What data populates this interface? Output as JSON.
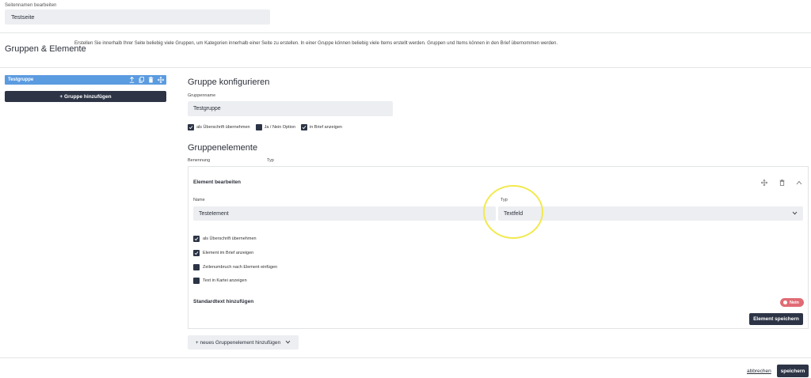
{
  "page_name": {
    "label": "Seitennamen bearbeiten",
    "value": "Testseite"
  },
  "groups_section": {
    "title": "Gruppen & Elemente",
    "description": "Erstellen Sie innerhalb Ihrer Seite beliebig viele Gruppen, um Kategorien innerhalb einer Seite zu erstellen. In einer Gruppe können beliebig viele Items erstellt werden. Gruppen und Items können in den Brief übernommen werden."
  },
  "sidebar": {
    "group_name": "Testgruppe",
    "group_icons": [
      "upload-icon",
      "copy-icon",
      "trash-icon",
      "move-icon"
    ],
    "add_group_label": "+ Gruppe hinzufügen"
  },
  "configure": {
    "title": "Gruppe konfigurieren",
    "groupname_label": "Gruppenname",
    "groupname_value": "Testgruppe",
    "options": [
      {
        "label": "als Überschrift übernehmen",
        "checked": true
      },
      {
        "label": "Ja / Nein Option",
        "checked": false
      },
      {
        "label": "in Brief anzeigen",
        "checked": true
      }
    ]
  },
  "group_elements": {
    "title": "Gruppenelemente",
    "col_name": "Benennung",
    "col_type": "Typ"
  },
  "element_edit": {
    "title": "Element bearbeiten",
    "action_icons": [
      "move-icon",
      "trash-icon",
      "chevron-up-icon"
    ],
    "name_label": "Name",
    "name_value": "Testelement",
    "type_label": "Typ",
    "type_value": "Textfeld",
    "options": [
      {
        "label": "als Überschrift übernehmen",
        "checked": true
      },
      {
        "label": "Element im Brief anzeigen",
        "checked": true
      },
      {
        "label": "Zeilenumbruch nach Element einfügen",
        "checked": false
      },
      {
        "label": "Text in Kartei anzeigen",
        "checked": false
      }
    ],
    "std_text_label": "Standardtext hinzufügen",
    "toggle_label": "Nein",
    "save_label": "Element speichern"
  },
  "add_element_label": "+ neues Gruppenelement hinzufügen",
  "footer": {
    "cancel_label": "abbrechen",
    "save_label": "speichern"
  },
  "colors": {
    "primary": "#2c3446",
    "accent": "#5b9be0",
    "toggle_off": "#e06b75",
    "highlight": "#f2e94e"
  }
}
